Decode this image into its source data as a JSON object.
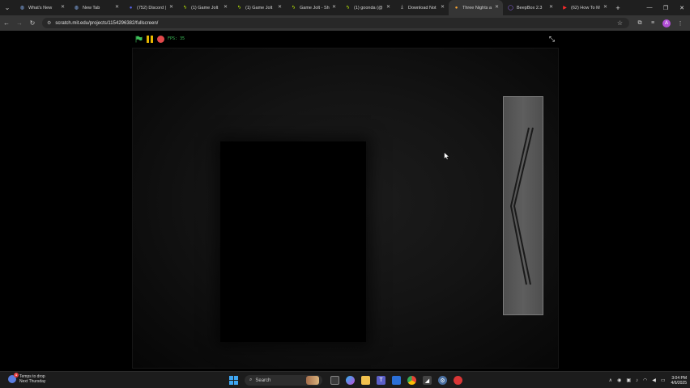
{
  "browser": {
    "tabs": [
      {
        "title": "What's New",
        "icon": "chrome-icon",
        "active": false
      },
      {
        "title": "New Tab",
        "icon": "chrome-icon",
        "active": false
      },
      {
        "title": "(752) Discord |",
        "icon": "discord-icon",
        "active": false
      },
      {
        "title": "(1) Game Jolt",
        "icon": "gamejolt-icon",
        "active": false
      },
      {
        "title": "(1) Game Jolt",
        "icon": "gamejolt-icon",
        "active": false
      },
      {
        "title": "Game Jolt - Sh",
        "icon": "gamejolt-icon",
        "active": false
      },
      {
        "title": "(1) goonda (@",
        "icon": "gamejolt-icon",
        "active": false
      },
      {
        "title": "Download Not",
        "icon": "download-icon",
        "active": false
      },
      {
        "title": "Three Nights a",
        "icon": "scratch-icon",
        "active": true
      },
      {
        "title": "BeepBox 2.3",
        "icon": "beepbox-icon",
        "active": false
      },
      {
        "title": "(62) How To M",
        "icon": "youtube-icon",
        "active": false
      }
    ],
    "new_tab_symbol": "+",
    "url": "scratch.mit.edu/projects/1154296382/fullscreen/",
    "avatar_letter": "A"
  },
  "player": {
    "fps_label": "FPS: 35"
  },
  "taskbar": {
    "weather_line1": "Temps to drop",
    "weather_line2": "Next Thursday",
    "weather_badge": "1",
    "search_placeholder": "Search",
    "time": "3:04 PM",
    "date": "4/6/2025"
  },
  "colors": {
    "green_flag": "#3ec25a",
    "pause": "#e8b700",
    "stop": "#e2494b",
    "avatar": "#b24fd6",
    "windows_accent": "#3fa6f2"
  }
}
